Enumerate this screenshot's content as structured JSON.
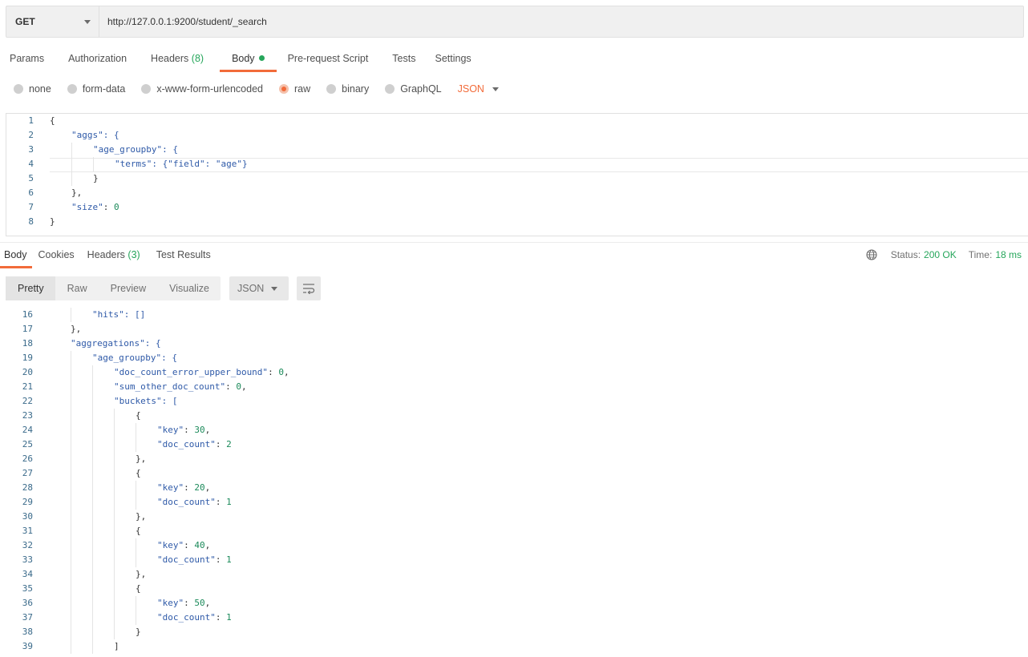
{
  "request": {
    "method": "GET",
    "url": "http://127.0.0.1:9200/student/_search"
  },
  "request_tabs": [
    {
      "label": "Params",
      "count": ""
    },
    {
      "label": "Authorization",
      "count": ""
    },
    {
      "label": "Headers",
      "count": "(8)"
    },
    {
      "label": "Body",
      "count": ""
    },
    {
      "label": "Pre-request Script",
      "count": ""
    },
    {
      "label": "Tests",
      "count": ""
    },
    {
      "label": "Settings",
      "count": ""
    }
  ],
  "body_types": [
    "none",
    "form-data",
    "x-www-form-urlencoded",
    "raw",
    "binary",
    "GraphQL"
  ],
  "body_format": "JSON",
  "request_body_lines": [
    {
      "n": "1",
      "text": "{"
    },
    {
      "n": "2",
      "text": "\"aggs\": {"
    },
    {
      "n": "3",
      "text": "\"age_groupby\": {"
    },
    {
      "n": "4",
      "text": "\"terms\": {\"field\": \"age\"}"
    },
    {
      "n": "5",
      "text": "}"
    },
    {
      "n": "6",
      "text": "},"
    },
    {
      "n": "7",
      "text": "\"size\": 0"
    },
    {
      "n": "8",
      "text": "}"
    }
  ],
  "response_tabs": [
    {
      "label": "Body",
      "count": ""
    },
    {
      "label": "Cookies",
      "count": ""
    },
    {
      "label": "Headers",
      "count": "(3)"
    },
    {
      "label": "Test Results",
      "count": ""
    }
  ],
  "status": {
    "status_label": "Status:",
    "status_value": "200 OK",
    "time_label": "Time:",
    "time_value": "18 ms"
  },
  "view_modes": [
    "Pretty",
    "Raw",
    "Preview",
    "Visualize"
  ],
  "response_format": "JSON",
  "response_lines": [
    {
      "n": "16",
      "text": "\"hits\": []"
    },
    {
      "n": "17",
      "text": "},"
    },
    {
      "n": "18",
      "text": "\"aggregations\": {"
    },
    {
      "n": "19",
      "text": "\"age_groupby\": {"
    },
    {
      "n": "20",
      "text": "\"doc_count_error_upper_bound\": 0,"
    },
    {
      "n": "21",
      "text": "\"sum_other_doc_count\": 0,"
    },
    {
      "n": "22",
      "text": "\"buckets\": ["
    },
    {
      "n": "23",
      "text": "{"
    },
    {
      "n": "24",
      "text": "\"key\": 30,"
    },
    {
      "n": "25",
      "text": "\"doc_count\": 2"
    },
    {
      "n": "26",
      "text": "},"
    },
    {
      "n": "27",
      "text": "{"
    },
    {
      "n": "28",
      "text": "\"key\": 20,"
    },
    {
      "n": "29",
      "text": "\"doc_count\": 1"
    },
    {
      "n": "30",
      "text": "},"
    },
    {
      "n": "31",
      "text": "{"
    },
    {
      "n": "32",
      "text": "\"key\": 40,"
    },
    {
      "n": "33",
      "text": "\"doc_count\": 1"
    },
    {
      "n": "34",
      "text": "},"
    },
    {
      "n": "35",
      "text": "{"
    },
    {
      "n": "36",
      "text": "\"key\": 50,"
    },
    {
      "n": "37",
      "text": "\"doc_count\": 1"
    },
    {
      "n": "38",
      "text": "}"
    },
    {
      "n": "39",
      "text": "]"
    }
  ],
  "colors": {
    "accent": "#f26b3a",
    "success": "#26a65b",
    "json_key": "#2f5aa8",
    "json_number": "#1b8a5a"
  },
  "icons": {
    "method_caret": "chevron-down-icon",
    "globe": "globe-icon",
    "wrap": "wrap-lines-icon"
  }
}
